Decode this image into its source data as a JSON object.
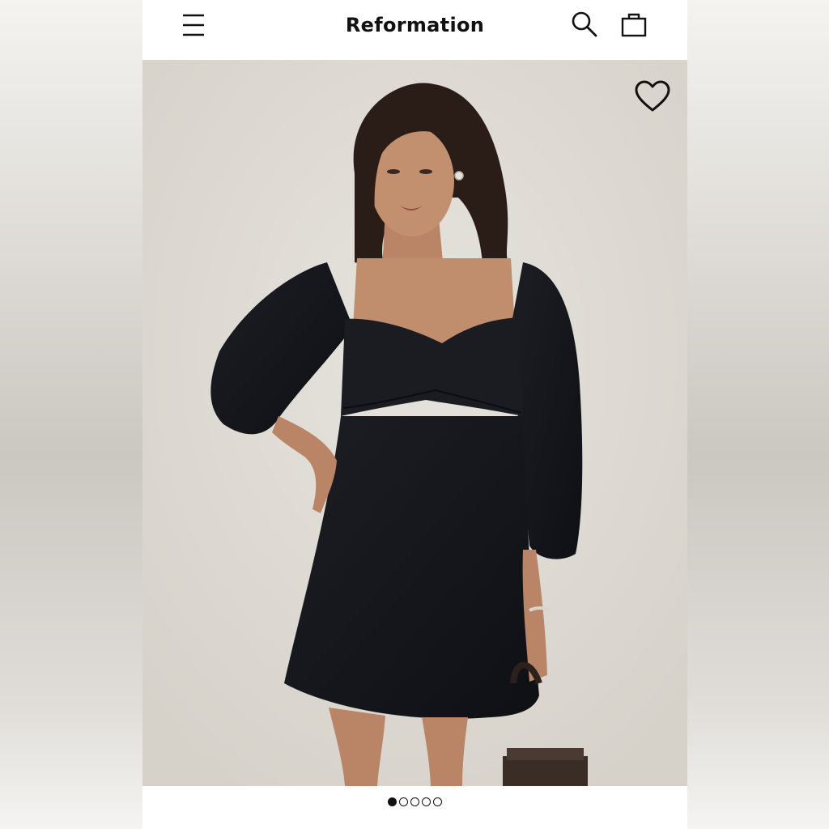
{
  "header": {
    "brand": "Reformation",
    "menu_icon": "hamburger-menu-icon",
    "search_icon": "search-icon",
    "bag_icon": "shopping-bag-icon"
  },
  "product_gallery": {
    "image_description_icon": "model-photo",
    "wishlist_icon": "heart-icon",
    "total_images": 5,
    "active_index": 0
  },
  "colors": {
    "background": "#ffffff",
    "text": "#111111",
    "photo_backdrop": "#dedad3",
    "dress": "#15171c"
  }
}
